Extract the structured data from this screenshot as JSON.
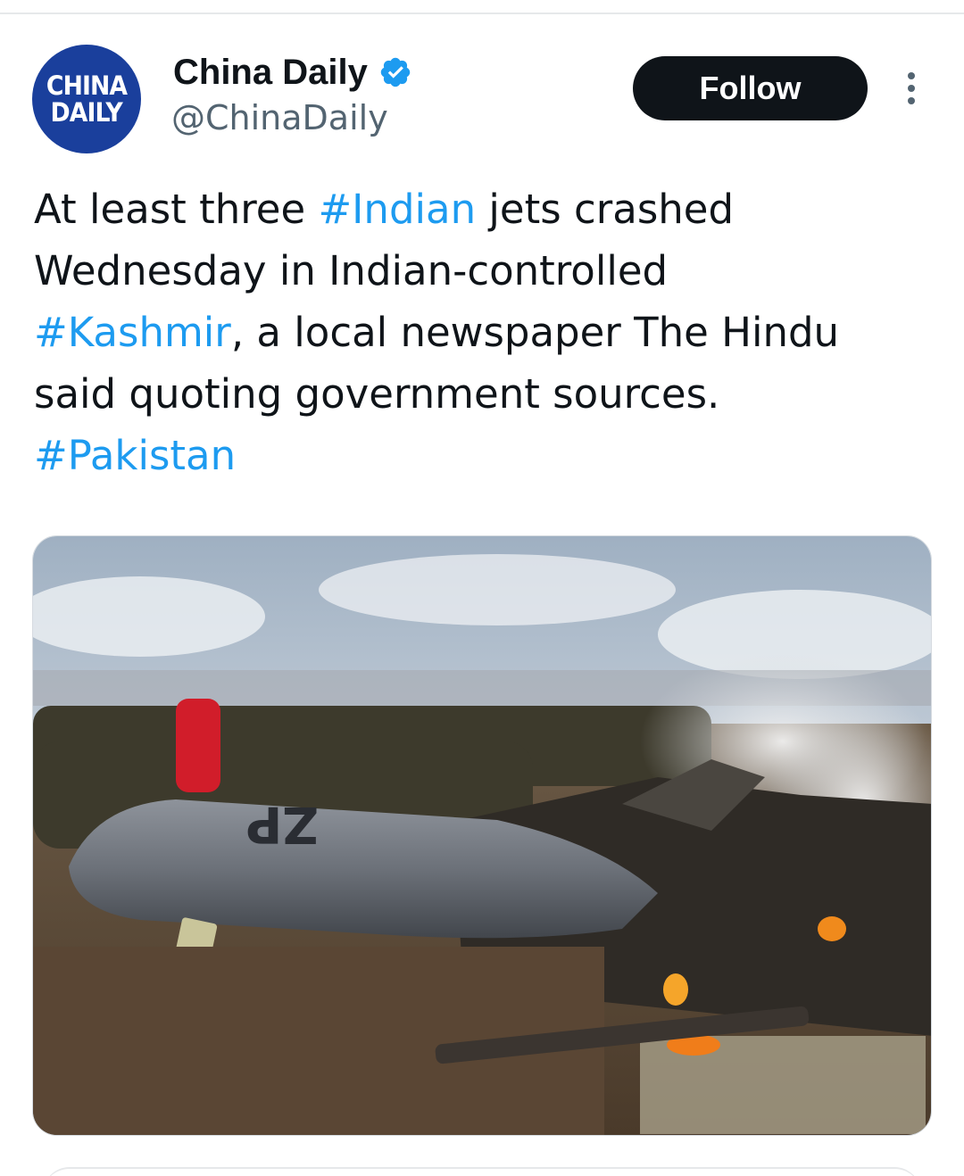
{
  "author": {
    "display_name": "China Daily",
    "handle": "@ChinaDaily",
    "avatar_text": [
      "CHINA",
      "DAILY"
    ],
    "verified": true
  },
  "actions": {
    "follow_label": "Follow"
  },
  "tweet": {
    "lines": [
      [
        {
          "text": "At least three ",
          "hashtag": false
        },
        {
          "text": "#Indian",
          "hashtag": true
        },
        {
          "text": " jets crashed",
          "hashtag": false
        }
      ],
      [
        {
          "text": "Wednesday in Indian-controlled",
          "hashtag": false
        }
      ],
      [
        {
          "text": "#Kashmir",
          "hashtag": true
        },
        {
          "text": ", a local newspaper The Hindu",
          "hashtag": false
        }
      ],
      [
        {
          "text": "said quoting government sources.",
          "hashtag": false
        }
      ],
      [
        {
          "text": "#Pakistan",
          "hashtag": true
        }
      ]
    ]
  },
  "media": {
    "aircraft_marking": "ZP"
  },
  "colors": {
    "link": "#1d9bf0",
    "text_primary": "#0f1419",
    "text_secondary": "#536471",
    "follow_bg": "#0f1419",
    "avatar_bg": "#1a3f9c"
  }
}
